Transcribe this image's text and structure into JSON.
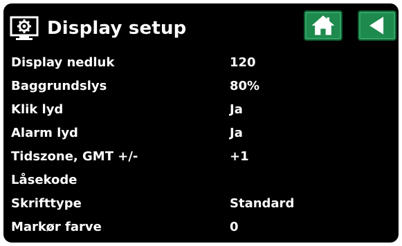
{
  "header": {
    "title": "Display setup",
    "icon": "display-settings-icon",
    "home_button_icon": "home-icon",
    "back_button_icon": "back-arrow-icon"
  },
  "colors": {
    "background": "#000000",
    "text": "#ffffff",
    "button_green": "#1f8a4e"
  },
  "settings": [
    {
      "label": "Display nedluk",
      "value": "120"
    },
    {
      "label": "Baggrundslys",
      "value": "80%"
    },
    {
      "label": "Klik lyd",
      "value": "Ja"
    },
    {
      "label": "Alarm lyd",
      "value": "Ja"
    },
    {
      "label": "Tidszone, GMT +/-",
      "value": "+1"
    },
    {
      "label": "Låsekode",
      "value": ""
    },
    {
      "label": "Skrifttype",
      "value": "Standard"
    },
    {
      "label": "Markør farve",
      "value": "0"
    }
  ]
}
